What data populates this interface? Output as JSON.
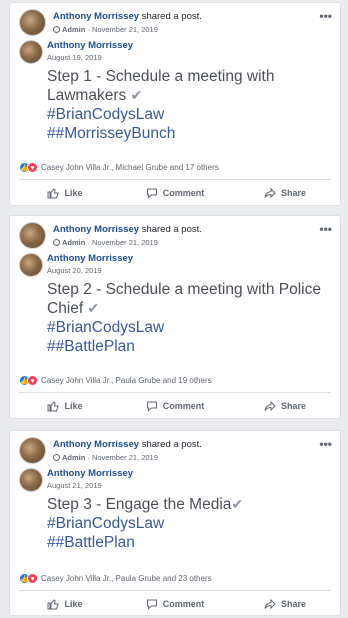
{
  "posts": [
    {
      "sharer": "Anthony Morrissey",
      "shared_text": "shared a post.",
      "role": "Admin",
      "share_date": "November 21, 2019",
      "author": "Anthony Morrissey",
      "author_date": "August 19, 2019",
      "body_line1": "Step 1 - Schedule a meeting with",
      "body_line2": "Lawmakers",
      "tag1": "#BrianCodysLaw",
      "tag2": "##MorrisseyBunch",
      "reactions": "Casey John Villa Jr., Michael Grube and 17 others"
    },
    {
      "sharer": "Anthony Morrissey",
      "shared_text": "shared a post.",
      "role": "Admin",
      "share_date": "November 21, 2019",
      "author": "Anthony Morrissey",
      "author_date": "August 20, 2019",
      "body_line1": "Step 2 - Schedule a meeting with Police",
      "body_line2": "Chief",
      "tag1": "#BrianCodysLaw",
      "tag2": "##BattlePlan",
      "reactions": "Casey John Villa Jr., Paula Grube and 19 others"
    },
    {
      "sharer": "Anthony Morrissey",
      "shared_text": "shared a post.",
      "role": "Admin",
      "share_date": "November 21, 2019",
      "author": "Anthony Morrissey",
      "author_date": "August 21, 2019",
      "body_line1": "Step 3 - Engage the Media",
      "body_line2": "",
      "tag1": "#BrianCodysLaw",
      "tag2": "##BattlePlan",
      "reactions": "Casey John Villa Jr., Paula Grube and 23 others"
    }
  ],
  "actions": {
    "like": "Like",
    "comment": "Comment",
    "share": "Share"
  },
  "more_label": "•••",
  "icons": {
    "check": "✔",
    "like_reaction": "like-icon",
    "love_reaction": "heart-icon"
  },
  "colors": {
    "link": "#385898",
    "name": "#1c4f91",
    "like": "#1877f2",
    "love": "#f33e58"
  }
}
